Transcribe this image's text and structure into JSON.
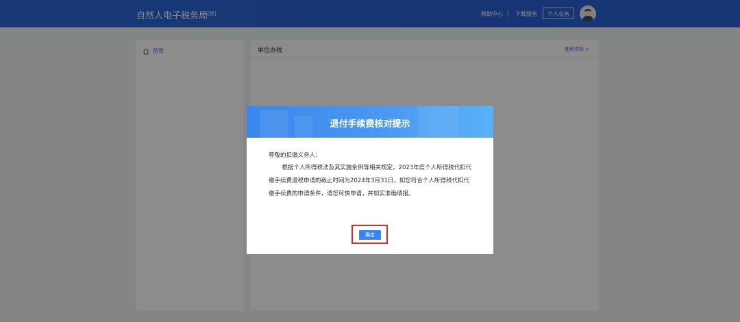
{
  "header": {
    "brand": "自然人电子税务局",
    "switch": "[切换]",
    "help": "帮助中心",
    "download": "下载服务",
    "personal": "个人业务"
  },
  "sidebar": {
    "home": "首页"
  },
  "main": {
    "title": "单位办税",
    "usage": "使用须知 >"
  },
  "modal": {
    "title": "退付手续费核对提示",
    "greeting": "尊敬的扣缴义务人：",
    "body": "根据个人所得税法及其实施条例等相关规定，2023年度个人所得税代扣代缴手续费退税申请的截止时间为2024年3月31日，如您符合个人所得税代扣代缴手续费的申请条件，请您尽快申请，并如实准确填报。",
    "confirm": "确定"
  },
  "colors": {
    "header": "#2e66d8",
    "accent": "#3a83ef",
    "highlight": "#e0262a"
  }
}
